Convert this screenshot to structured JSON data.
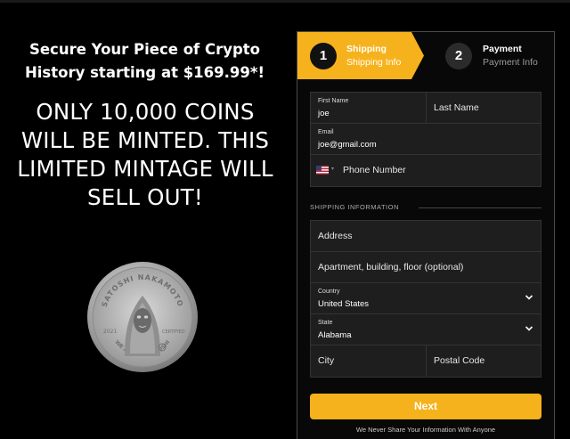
{
  "hero": {
    "headline_line1": "Secure Your Piece of Crypto",
    "headline_line2": "History starting at $169.99*!",
    "big_line1": "ONLY 10,000 COINS",
    "big_line2": "WILL BE MINTED. THIS",
    "big_line3": "LIMITED MINTAGE WILL",
    "big_line4": "SELL OUT!",
    "coin_top": "SATOSHI NAKAMOTO",
    "coin_bottom": "WE ARE ALL SATOSHI",
    "coin_year": "2021",
    "coin_left": "2021",
    "coin_right": "CERTIFIED"
  },
  "steps": [
    {
      "num": "1",
      "title": "Shipping",
      "sub": "Shipping Info",
      "active": true
    },
    {
      "num": "2",
      "title": "Payment",
      "sub": "Payment Info",
      "active": false
    }
  ],
  "form": {
    "first_name_label": "First Name",
    "first_name_value": "joe",
    "last_name_placeholder": "Last Name",
    "email_label": "Email",
    "email_value": "joe@gmail.com",
    "phone_placeholder": "Phone Number",
    "phone_caret": "▾",
    "section_title": "SHIPPING INFORMATION",
    "address_placeholder": "Address",
    "apt_placeholder": "Apartment, building, floor (optional)",
    "country_label": "Country",
    "country_value": "United States",
    "state_label": "State",
    "state_value": "Alabama",
    "city_placeholder": "City",
    "postal_placeholder": "Postal Code",
    "next_label": "Next",
    "privacy_note": "We Never Share Your Information With Anyone"
  },
  "icons": {
    "flag": "us-flag-icon",
    "dropdown": "chevron-down-icon"
  },
  "colors": {
    "accent": "#f6b21c",
    "background": "#000000",
    "field_bg": "#1e1e1e"
  }
}
